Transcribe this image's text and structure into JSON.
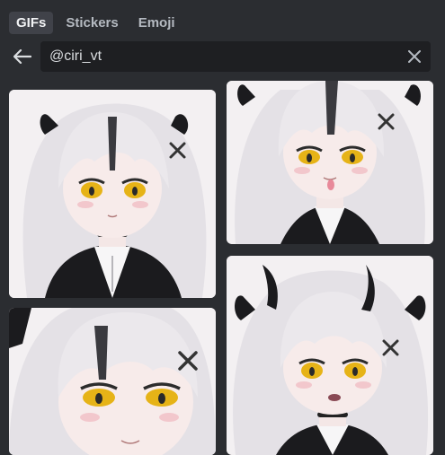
{
  "tabs": [
    {
      "label": "GIFs",
      "active": true
    },
    {
      "label": "Stickers",
      "active": false
    },
    {
      "label": "Emoji",
      "active": false
    }
  ],
  "search": {
    "value": "@ciri_vt",
    "icons": {
      "back": "arrow-left-icon",
      "clear": "close-icon"
    }
  },
  "gifs": [
    {
      "subject": "white-haired anime vtuber, neutral expression"
    },
    {
      "subject": "white-haired anime vtuber, tongue out"
    },
    {
      "subject": "white-haired anime vtuber, closeup smile"
    },
    {
      "subject": "white-haired anime vtuber with horns, surprised"
    }
  ],
  "colors": {
    "background": "#2b2d31",
    "search_bg": "#1e1f22",
    "tab_active_bg": "#404249",
    "text": "#dbdee1",
    "muted": "#b5bac1",
    "hair": "#e9e6ea",
    "eyes": "#e6b317",
    "outfit": "#1b1b1e"
  }
}
